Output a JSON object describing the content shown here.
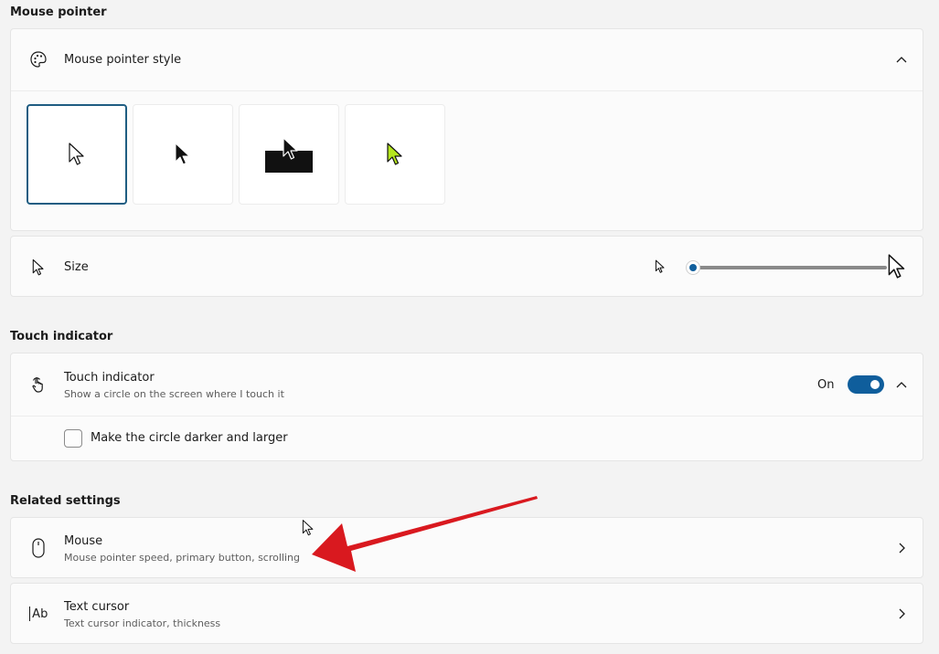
{
  "mouse_pointer": {
    "section_title": "Mouse pointer",
    "style_label": "Mouse pointer style",
    "styles": [
      "white",
      "black",
      "inverted",
      "custom"
    ],
    "custom_color": "#b5e61d",
    "size_label": "Size",
    "size_value": 0.0
  },
  "touch_indicator": {
    "section_title": "Touch indicator",
    "title": "Touch indicator",
    "subtitle": "Show a circle on the screen where I touch it",
    "toggle_label": "On",
    "toggle_on": true,
    "checkbox_label": "Make the circle darker and larger",
    "checkbox_checked": false
  },
  "related": {
    "section_title": "Related settings",
    "mouse_title": "Mouse",
    "mouse_sub": "Mouse pointer speed, primary button, scrolling",
    "text_cursor_title": "Text cursor",
    "text_cursor_sub": "Text cursor indicator, thickness",
    "text_cursor_icon": "Ab"
  },
  "colors": {
    "accent": "#0f5e9c",
    "annotation_arrow": "#d9191f"
  }
}
